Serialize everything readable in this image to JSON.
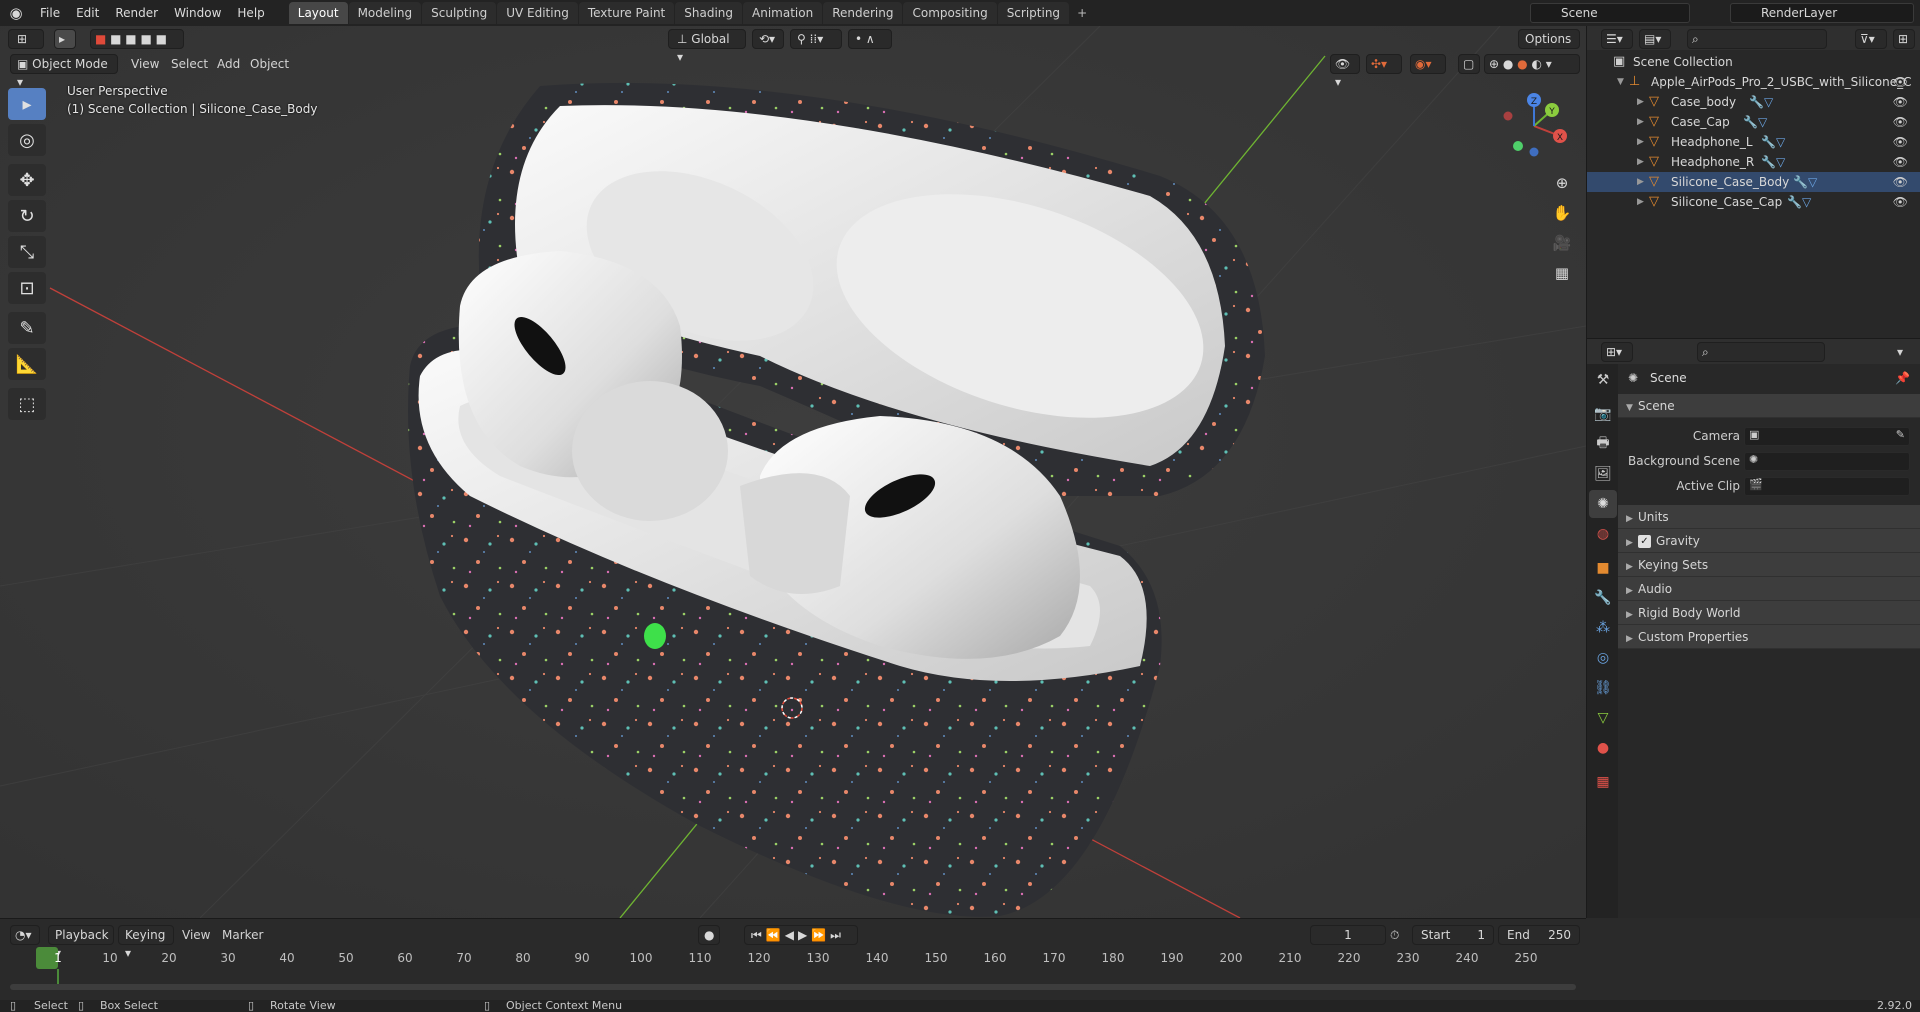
{
  "topbar": {
    "menus": [
      "File",
      "Edit",
      "Render",
      "Window",
      "Help"
    ],
    "tabs": [
      "Layout",
      "Modeling",
      "Sculpting",
      "UV Editing",
      "Texture Paint",
      "Shading",
      "Animation",
      "Rendering",
      "Compositing",
      "Scripting"
    ],
    "add_tab": "+",
    "scene": "Scene",
    "render_layer": "RenderLayer"
  },
  "viewport_header": {
    "mode": "Object Mode",
    "menus": [
      "View",
      "Select",
      "Add",
      "Object"
    ],
    "orientation": "Global",
    "options": "Options"
  },
  "viewport": {
    "perspective": "User Perspective",
    "collection_info": "(1) Scene Collection | Silicone_Case_Body",
    "gizmo": {
      "x": "X",
      "y": "Y",
      "z": "Z"
    }
  },
  "outliner": {
    "root": "Scene Collection",
    "collection": "Apple_AirPods_Pro_2_USBC_with_Silicone_C",
    "items": [
      "Case_body",
      "Case_Cap",
      "Headphone_L",
      "Headphone_R",
      "Silicone_Case_Body",
      "Silicone_Case_Cap"
    ]
  },
  "properties": {
    "title": "Scene",
    "section": "Scene",
    "fields": [
      {
        "label": "Camera"
      },
      {
        "label": "Background Scene"
      },
      {
        "label": "Active Clip"
      }
    ],
    "panels": [
      {
        "label": "Units",
        "checkbox": false
      },
      {
        "label": "Gravity",
        "checkbox": true
      },
      {
        "label": "Keying Sets",
        "checkbox": false
      },
      {
        "label": "Audio",
        "checkbox": false
      },
      {
        "label": "Rigid Body World",
        "checkbox": false
      },
      {
        "label": "Custom Properties",
        "checkbox": false
      }
    ]
  },
  "timeline": {
    "menus": [
      "Playback",
      "Keying",
      "View",
      "Marker"
    ],
    "current_frame": "1",
    "start_label": "Start",
    "start": "1",
    "end_label": "End",
    "end": "250",
    "ticks": [
      "1",
      "10",
      "20",
      "30",
      "40",
      "50",
      "60",
      "70",
      "80",
      "90",
      "100",
      "110",
      "120",
      "130",
      "140",
      "150",
      "160",
      "170",
      "180",
      "190",
      "200",
      "210",
      "220",
      "230",
      "240",
      "250"
    ]
  },
  "statusbar": {
    "select": "Select",
    "box_select": "Box Select",
    "rotate_view": "Rotate View",
    "context_menu": "Object Context Menu",
    "version": "2.92.0"
  },
  "colors": {
    "accent": "#5680c2",
    "case_dark": "#2e2f33",
    "speck_orange": "#e8876a",
    "case_white": "#f2f2f2",
    "led_green": "#3ee04a",
    "axis_x": "#c0403a",
    "axis_y": "#6fb532",
    "axis_z": "#3f77d6"
  }
}
